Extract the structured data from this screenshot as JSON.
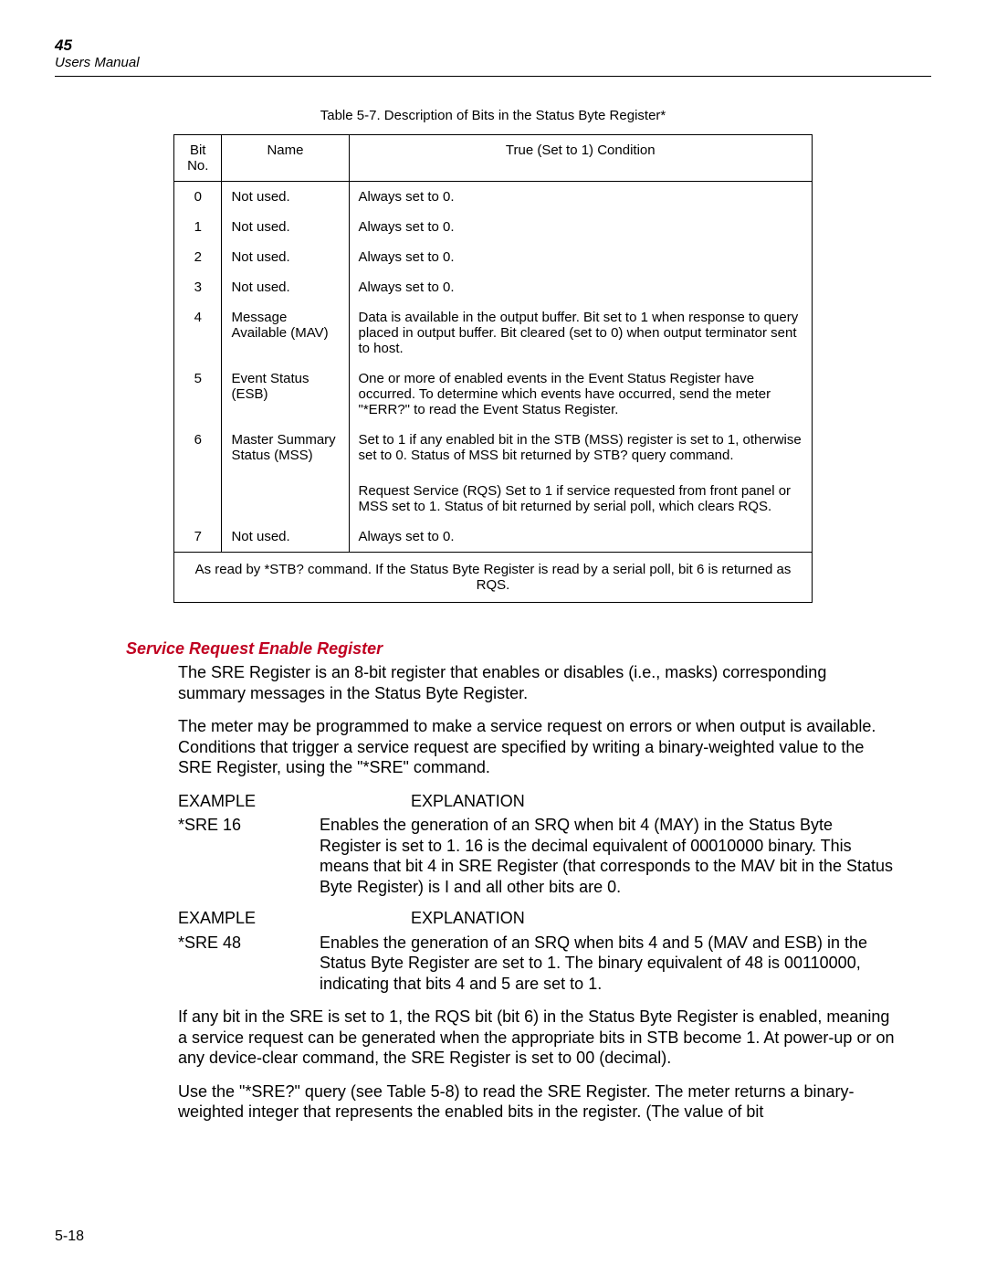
{
  "header": {
    "page_num": "45",
    "manual": "Users Manual"
  },
  "table": {
    "caption": "Table 5-7. Description of Bits in the Status Byte Register*",
    "head": {
      "bit": "Bit No.",
      "name": "Name",
      "cond": "True (Set to 1) Condition"
    },
    "rows": {
      "r0": {
        "bit": "0",
        "name": "Not used.",
        "cond": "Always set to 0."
      },
      "r1": {
        "bit": "1",
        "name": "Not used.",
        "cond": "Always set to 0."
      },
      "r2": {
        "bit": "2",
        "name": "Not used.",
        "cond": "Always set to 0."
      },
      "r3": {
        "bit": "3",
        "name": "Not used.",
        "cond": "Always set to 0."
      },
      "r4": {
        "bit": "4",
        "name": "Message Available (MAV)",
        "cond": "Data is available in the output buffer. Bit set to 1 when response to query placed in output buffer. Bit cleared (set to 0) when output terminator sent to host."
      },
      "r5": {
        "bit": "5",
        "name": "Event Status (ESB)",
        "cond": "One or more of enabled events in the Event Status Register have occurred. To determine which events have occurred, send the meter \"*ERR?\" to read the Event Status Register."
      },
      "r6": {
        "bit": "6",
        "name": "Master Summary Status   (MSS)",
        "cond": "Set to 1 if any enabled bit in the STB (MSS) register is set to 1, otherwise set to 0. Status of MSS bit returned by STB? query command."
      },
      "r6b": {
        "cond": "Request Service (RQS) Set to 1 if service requested from front panel or MSS set to 1. Status of bit returned by serial poll, which clears RQS."
      },
      "r7": {
        "bit": "7",
        "name": "Not used.",
        "cond": "Always set to 0."
      }
    },
    "footnote": "As read by *STB? command. If the Status Byte Register is read by a serial poll, bit 6 is returned as RQS."
  },
  "section": {
    "title": "Service Request Enable Register",
    "p1": "The SRE Register is an 8-bit register that enables or disables (i.e., masks) corresponding summary messages in the Status Byte Register.",
    "p2": "The meter may be programmed to make a service request on errors or when output is available. Conditions that trigger a service request are specified by writing a binary-weighted value to the SRE Register, using the \"*SRE\" command.",
    "ex_header1_a": "EXAMPLE",
    "ex_header1_b": "EXPLANATION",
    "ex1_label": "*SRE 16",
    "ex1_text": "Enables the generation of an SRQ when bit 4 (MAY) in the Status Byte Register is set to 1. 16 is the decimal equivalent of 00010000 binary. This means that bit 4 in SRE Register (that corresponds to the MAV bit in the Status Byte Register) is I and all other bits are 0.",
    "ex_header2_a": "EXAMPLE",
    "ex_header2_b": "EXPLANATION",
    "ex2_label": "*SRE 48",
    "ex2_text": "Enables the generation of an SRQ when bits 4 and 5 (MAV and ESB) in the Status Byte Register are set to 1. The binary equivalent of 48 is 00110000, indicating that bits 4 and 5 are set to 1.",
    "p3": "If any bit in the SRE is set to 1, the RQS bit (bit 6) in the Status Byte Register is enabled, meaning a service request can be generated when the appropriate bits in STB become 1. At power-up or on any device-clear command, the SRE Register is set to 00 (decimal).",
    "p4": "Use the \"*SRE?\" query (see Table 5-8) to read the SRE Register. The meter returns a binary-weighted integer that represents the enabled bits in the register.  (The value of bit"
  },
  "footer": {
    "num": "5-18"
  }
}
